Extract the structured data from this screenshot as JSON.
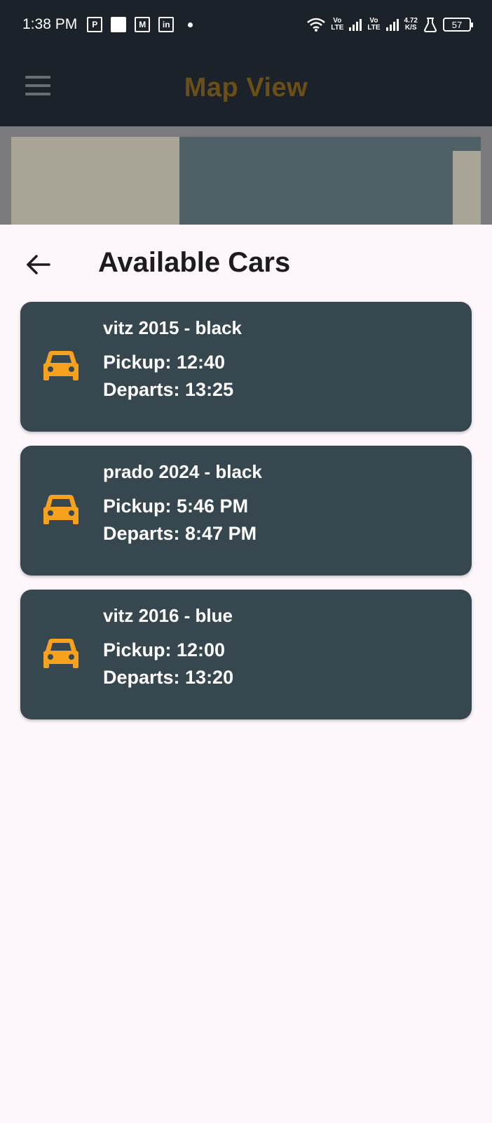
{
  "status_bar": {
    "time": "1:38 PM",
    "net_speed_value": "4.72",
    "net_speed_unit": "K/S",
    "lte1_top": "Vo",
    "lte1_bottom": "LTE",
    "lte2_top": "Vo",
    "lte2_bottom": "LTE",
    "battery": "57"
  },
  "app_bar": {
    "title": "Map View"
  },
  "sheet": {
    "title": "Available Cars"
  },
  "cars": [
    {
      "name": "vitz 2015 - black",
      "pickup": "Pickup: 12:40",
      "departs": "Departs: 13:25"
    },
    {
      "name": "prado 2024 - black",
      "pickup": "Pickup: 5:46 PM",
      "departs": "Departs: 8:47 PM"
    },
    {
      "name": "vitz 2016 - blue",
      "pickup": "Pickup: 12:00",
      "departs": "Departs: 13:20"
    }
  ],
  "colors": {
    "accent": "#f6a21e",
    "card": "#37474f",
    "background": "#fdf7fc",
    "header": "#1c2229"
  }
}
